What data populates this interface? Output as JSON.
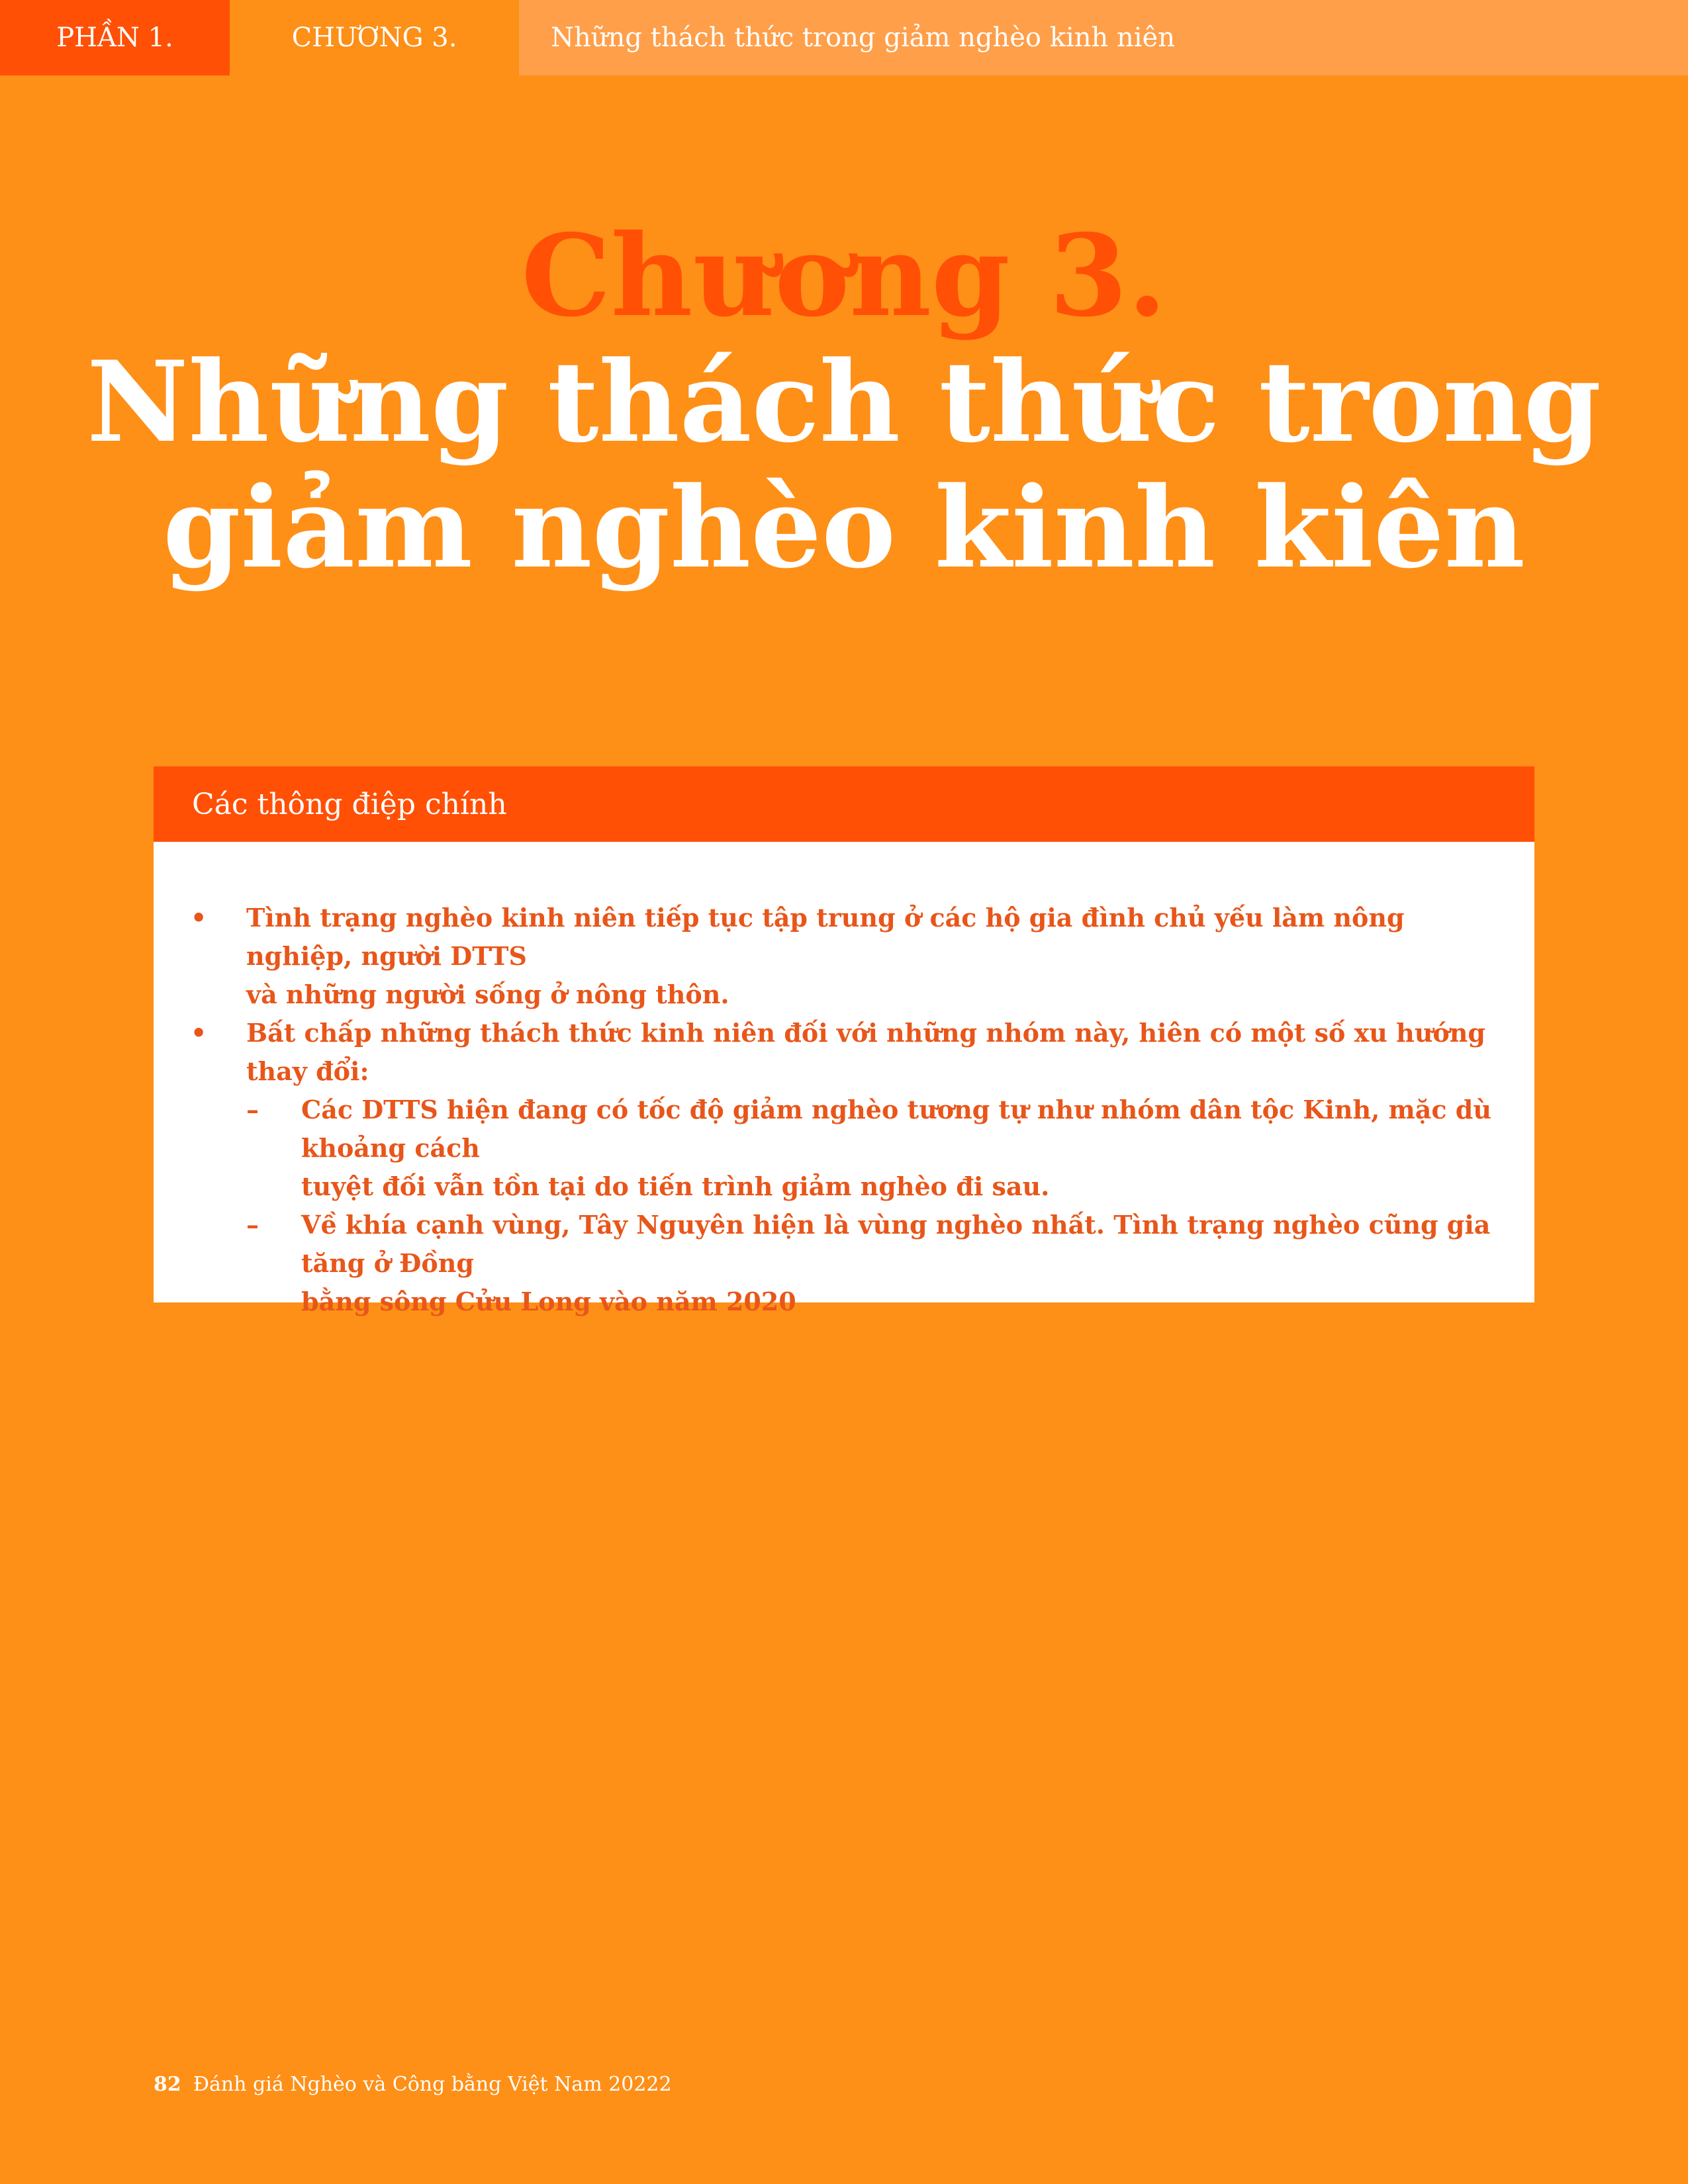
{
  "header": {
    "part_label": "PHẦN 1.",
    "chapter_label": "CHƯƠNG 3.",
    "chapter_title": "Những thách thức trong giảm nghèo kinh niên"
  },
  "heading": {
    "chapter": "Chương 3.",
    "title_line1": "Những thách thức trong",
    "title_line2": "giảm nghèo kinh kiên"
  },
  "key_messages": {
    "title": "Các thông điệp chính",
    "bullets": [
      {
        "marker": "•",
        "line1": "Tình trạng nghèo kinh niên tiếp tục tập trung ở các hộ gia đình chủ yếu làm nông nghiệp, người DTTS",
        "line2": "và những người sống ở nông thôn."
      },
      {
        "marker": "•",
        "line1": "Bất chấp những thách thức kinh niên đối với những nhóm này, hiên có một số xu hướng thay đổi:"
      }
    ],
    "sub_bullets": [
      {
        "marker": "–",
        "line1": "Các DTTS hiện đang có tốc độ giảm nghèo tương tự như nhóm dân tộc Kinh, mặc dù khoảng cách",
        "line2": "tuyệt đối vẫn tồn tại do tiến trình giảm nghèo đi sau."
      },
      {
        "marker": "–",
        "line1": "Về khía cạnh vùng, Tây Nguyên hiện là vùng nghèo nhất. Tình trạng nghèo cũng gia tăng ở Đồng",
        "line2": "bằng sông Cửu Long vào năm 2020"
      }
    ]
  },
  "footer": {
    "page_number": "82",
    "publication": "Đánh giá Nghèo và Công bằng Việt Nam 20222"
  },
  "colors": {
    "background": "#FE8F17",
    "accent": "#FF5005",
    "text_accent": "#E8561A",
    "header_title_bg": "#FF9F4A"
  }
}
